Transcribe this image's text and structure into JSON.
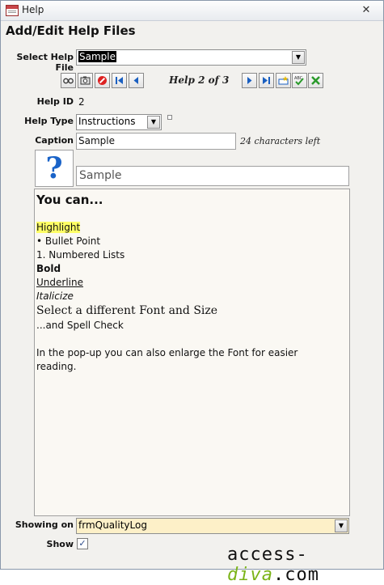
{
  "window": {
    "title": "Help",
    "close_glyph": "✕"
  },
  "form": {
    "title": "Add/Edit Help Files"
  },
  "select_help_file": {
    "label": "Select Help File",
    "value": "Sample"
  },
  "nav": {
    "counter": "Help 2 of 3",
    "buttons": [
      "binoculars-icon",
      "camera-icon",
      "cancel-icon",
      "first-record-icon",
      "prev-record-icon",
      "next-record-icon",
      "last-record-icon",
      "new-record-icon",
      "spell-check-icon",
      "close-form-icon"
    ]
  },
  "help_id": {
    "label": "Help ID",
    "value": "2"
  },
  "help_type": {
    "label": "Help Type",
    "value": "Instructions"
  },
  "caption": {
    "label": "Caption",
    "value": "Sample",
    "chars_left": "24 characters left"
  },
  "preview": {
    "icon": "?",
    "title": "Sample"
  },
  "content": {
    "heading": "You can...",
    "highlight": "Highlight",
    "bullet": "• Bullet Point",
    "numbered": "1. Numbered Lists",
    "bold": "Bold",
    "underline": "Underline",
    "italic": "Italicize",
    "font": "Select a different Font and Size",
    "spell": "...and Spell Check",
    "popup_line1": "In the pop-up you can also enlarge the Font for easier",
    "popup_line2": "reading."
  },
  "showing_on": {
    "label": "Showing on",
    "value": "frmQualityLog"
  },
  "show": {
    "label": "Show",
    "checked": "✓"
  },
  "brand": {
    "left": "access-",
    "mid": "diva",
    "right": ".com"
  },
  "colors": {
    "accent": "#1a63c8",
    "highlight": "#ffff66",
    "showing_bg": "#fdf0c8"
  }
}
